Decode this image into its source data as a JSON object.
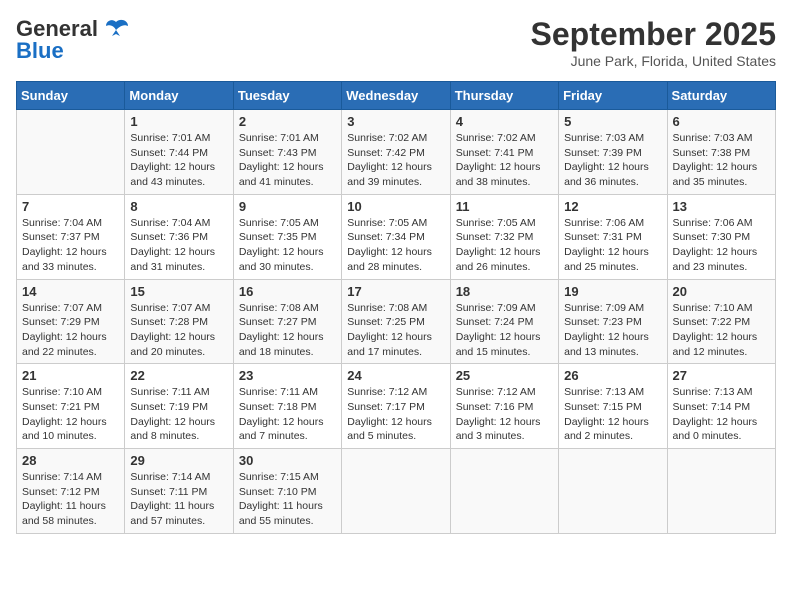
{
  "header": {
    "logo_line1": "General",
    "logo_line2": "Blue",
    "title": "September 2025",
    "subtitle": "June Park, Florida, United States"
  },
  "days_of_week": [
    "Sunday",
    "Monday",
    "Tuesday",
    "Wednesday",
    "Thursday",
    "Friday",
    "Saturday"
  ],
  "weeks": [
    [
      {
        "day": "",
        "info": ""
      },
      {
        "day": "1",
        "info": "Sunrise: 7:01 AM\nSunset: 7:44 PM\nDaylight: 12 hours\nand 43 minutes."
      },
      {
        "day": "2",
        "info": "Sunrise: 7:01 AM\nSunset: 7:43 PM\nDaylight: 12 hours\nand 41 minutes."
      },
      {
        "day": "3",
        "info": "Sunrise: 7:02 AM\nSunset: 7:42 PM\nDaylight: 12 hours\nand 39 minutes."
      },
      {
        "day": "4",
        "info": "Sunrise: 7:02 AM\nSunset: 7:41 PM\nDaylight: 12 hours\nand 38 minutes."
      },
      {
        "day": "5",
        "info": "Sunrise: 7:03 AM\nSunset: 7:39 PM\nDaylight: 12 hours\nand 36 minutes."
      },
      {
        "day": "6",
        "info": "Sunrise: 7:03 AM\nSunset: 7:38 PM\nDaylight: 12 hours\nand 35 minutes."
      }
    ],
    [
      {
        "day": "7",
        "info": "Sunrise: 7:04 AM\nSunset: 7:37 PM\nDaylight: 12 hours\nand 33 minutes."
      },
      {
        "day": "8",
        "info": "Sunrise: 7:04 AM\nSunset: 7:36 PM\nDaylight: 12 hours\nand 31 minutes."
      },
      {
        "day": "9",
        "info": "Sunrise: 7:05 AM\nSunset: 7:35 PM\nDaylight: 12 hours\nand 30 minutes."
      },
      {
        "day": "10",
        "info": "Sunrise: 7:05 AM\nSunset: 7:34 PM\nDaylight: 12 hours\nand 28 minutes."
      },
      {
        "day": "11",
        "info": "Sunrise: 7:05 AM\nSunset: 7:32 PM\nDaylight: 12 hours\nand 26 minutes."
      },
      {
        "day": "12",
        "info": "Sunrise: 7:06 AM\nSunset: 7:31 PM\nDaylight: 12 hours\nand 25 minutes."
      },
      {
        "day": "13",
        "info": "Sunrise: 7:06 AM\nSunset: 7:30 PM\nDaylight: 12 hours\nand 23 minutes."
      }
    ],
    [
      {
        "day": "14",
        "info": "Sunrise: 7:07 AM\nSunset: 7:29 PM\nDaylight: 12 hours\nand 22 minutes."
      },
      {
        "day": "15",
        "info": "Sunrise: 7:07 AM\nSunset: 7:28 PM\nDaylight: 12 hours\nand 20 minutes."
      },
      {
        "day": "16",
        "info": "Sunrise: 7:08 AM\nSunset: 7:27 PM\nDaylight: 12 hours\nand 18 minutes."
      },
      {
        "day": "17",
        "info": "Sunrise: 7:08 AM\nSunset: 7:25 PM\nDaylight: 12 hours\nand 17 minutes."
      },
      {
        "day": "18",
        "info": "Sunrise: 7:09 AM\nSunset: 7:24 PM\nDaylight: 12 hours\nand 15 minutes."
      },
      {
        "day": "19",
        "info": "Sunrise: 7:09 AM\nSunset: 7:23 PM\nDaylight: 12 hours\nand 13 minutes."
      },
      {
        "day": "20",
        "info": "Sunrise: 7:10 AM\nSunset: 7:22 PM\nDaylight: 12 hours\nand 12 minutes."
      }
    ],
    [
      {
        "day": "21",
        "info": "Sunrise: 7:10 AM\nSunset: 7:21 PM\nDaylight: 12 hours\nand 10 minutes."
      },
      {
        "day": "22",
        "info": "Sunrise: 7:11 AM\nSunset: 7:19 PM\nDaylight: 12 hours\nand 8 minutes."
      },
      {
        "day": "23",
        "info": "Sunrise: 7:11 AM\nSunset: 7:18 PM\nDaylight: 12 hours\nand 7 minutes."
      },
      {
        "day": "24",
        "info": "Sunrise: 7:12 AM\nSunset: 7:17 PM\nDaylight: 12 hours\nand 5 minutes."
      },
      {
        "day": "25",
        "info": "Sunrise: 7:12 AM\nSunset: 7:16 PM\nDaylight: 12 hours\nand 3 minutes."
      },
      {
        "day": "26",
        "info": "Sunrise: 7:13 AM\nSunset: 7:15 PM\nDaylight: 12 hours\nand 2 minutes."
      },
      {
        "day": "27",
        "info": "Sunrise: 7:13 AM\nSunset: 7:14 PM\nDaylight: 12 hours\nand 0 minutes."
      }
    ],
    [
      {
        "day": "28",
        "info": "Sunrise: 7:14 AM\nSunset: 7:12 PM\nDaylight: 11 hours\nand 58 minutes."
      },
      {
        "day": "29",
        "info": "Sunrise: 7:14 AM\nSunset: 7:11 PM\nDaylight: 11 hours\nand 57 minutes."
      },
      {
        "day": "30",
        "info": "Sunrise: 7:15 AM\nSunset: 7:10 PM\nDaylight: 11 hours\nand 55 minutes."
      },
      {
        "day": "",
        "info": ""
      },
      {
        "day": "",
        "info": ""
      },
      {
        "day": "",
        "info": ""
      },
      {
        "day": "",
        "info": ""
      }
    ]
  ]
}
